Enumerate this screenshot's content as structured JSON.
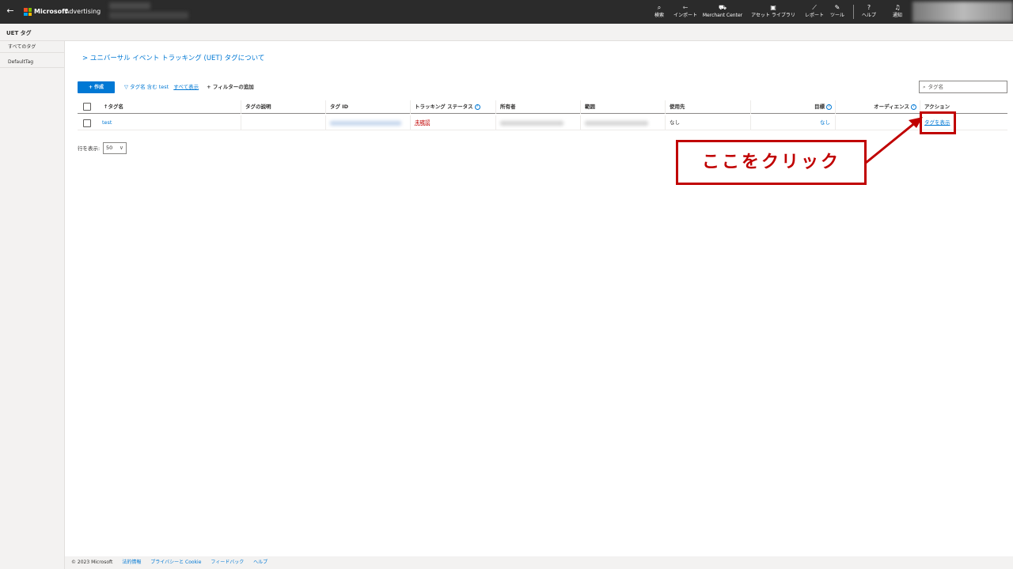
{
  "topbar": {
    "back_icon": "←",
    "brand": "Microsoft",
    "brand_sub": "Advertising",
    "brand_colors": [
      "#f25022",
      "#7fba00",
      "#00a4ef",
      "#ffb900"
    ],
    "tools": [
      {
        "id": "search",
        "icon": "⌕",
        "label": "検索"
      },
      {
        "id": "import",
        "icon": "⇽",
        "label": "インポート"
      },
      {
        "id": "merchant",
        "icon": "⛟",
        "label": "Merchant Center"
      },
      {
        "id": "assets",
        "icon": "▣",
        "label": "アセット ライブラリ"
      },
      {
        "id": "reports",
        "icon": "⟋",
        "label": "レポート"
      },
      {
        "id": "tools",
        "icon": "✎",
        "label": "ツール"
      },
      {
        "id": "help",
        "icon": "?",
        "label": "ヘルプ"
      },
      {
        "id": "notify",
        "icon": "♫",
        "label": "通知"
      }
    ]
  },
  "subheader": {
    "title": "UET タグ"
  },
  "sidebar": {
    "items": [
      {
        "label": "すべてのタグ"
      },
      {
        "label": "DefaultTag"
      }
    ]
  },
  "main": {
    "about_link": "ユニバーサル イベント トラッキング (UET) タグについて",
    "about_chevron": ">",
    "create_button": "+ 作成",
    "filter": {
      "icon": "▽",
      "text": "タグ名 含む test",
      "show_all": "すべて表示",
      "add_filter": "+ フィルターの追加"
    },
    "search_placeholder": "タグ名",
    "search_icon": "⌕",
    "table": {
      "headers": {
        "name": "↑タグ名",
        "description": "タグの説明",
        "tag_id": "タグ ID",
        "tracking_status": "トラッキング ステータス",
        "owner": "所有者",
        "scope": "範囲",
        "used_by": "使用先",
        "goals": "目標",
        "audiences": "オーディエンス",
        "action": "アクション"
      },
      "info_icon": "?",
      "rows": [
        {
          "name": "test",
          "description": "",
          "tracking_status": "未確認",
          "used_by": "なし",
          "goals": "なし",
          "action": "タグを表示"
        }
      ]
    },
    "rows_per_page": {
      "label": "行を表示:",
      "value": "50",
      "chevron": "∨"
    }
  },
  "annotation": {
    "callout": "ここをクリック",
    "color": "#c00000"
  },
  "footer": {
    "copyright": "© 2023 Microsoft",
    "links": [
      "法的情報",
      "プライバシーと Cookie",
      "フィードバック",
      "ヘルプ"
    ]
  },
  "colors": {
    "accent": "#0078d4",
    "status_red": "#c00000",
    "topbar": "#2b2b2b"
  }
}
